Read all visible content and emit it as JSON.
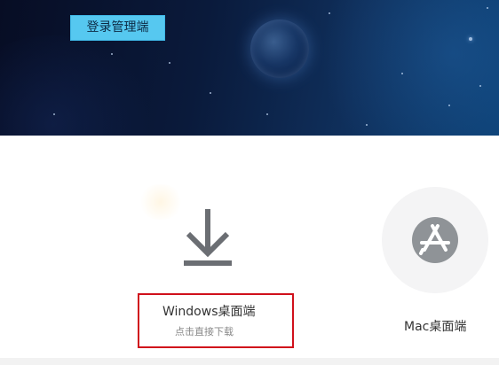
{
  "header": {
    "admin_login_label": "登录管理端"
  },
  "downloads": {
    "windows": {
      "title": "Windows桌面端",
      "subtitle": "点击直接下载",
      "icon": "download-icon"
    },
    "mac": {
      "title": "Mac桌面端",
      "icon": "app-store-icon"
    }
  },
  "colors": {
    "highlight_border": "#d0101b",
    "admin_button": "#56c8f0",
    "icon_gray": "#6b6e73",
    "mac_icon_bg": "#8f9397"
  }
}
